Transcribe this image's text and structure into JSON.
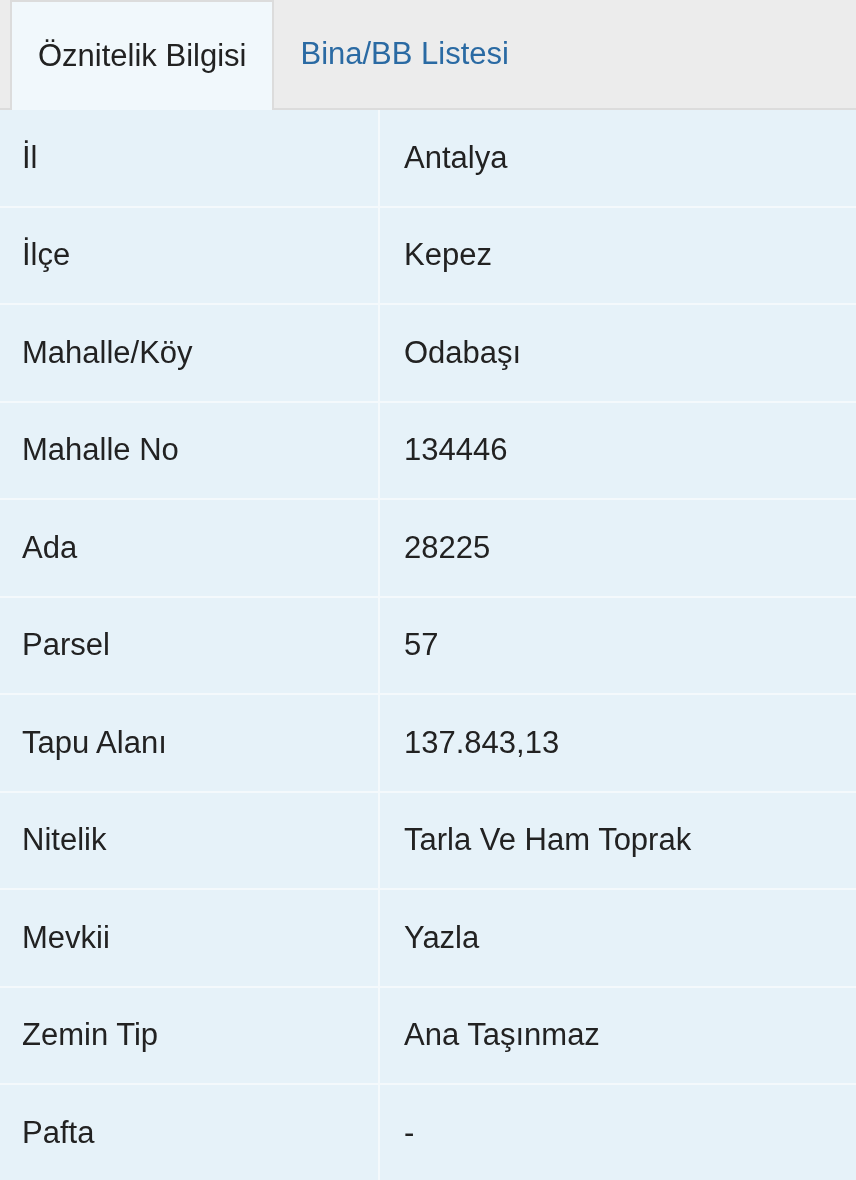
{
  "tabs": [
    {
      "label": "Öznitelik Bilgisi",
      "selected": true
    },
    {
      "label": "Bina/BB Listesi",
      "selected": false
    }
  ],
  "rows": [
    {
      "label": "İl",
      "value": "Antalya"
    },
    {
      "label": "İlçe",
      "value": "Kepez"
    },
    {
      "label": "Mahalle/Köy",
      "value": "Odabaşı"
    },
    {
      "label": "Mahalle No",
      "value": "134446"
    },
    {
      "label": "Ada",
      "value": "28225"
    },
    {
      "label": "Parsel",
      "value": "57"
    },
    {
      "label": "Tapu Alanı",
      "value": "137.843,13"
    },
    {
      "label": "Nitelik",
      "value": "Tarla Ve Ham Toprak"
    },
    {
      "label": "Mevkii",
      "value": "Yazla"
    },
    {
      "label": "Zemin Tip",
      "value": "Ana Taşınmaz"
    },
    {
      "label": "Pafta",
      "value": "-"
    }
  ]
}
